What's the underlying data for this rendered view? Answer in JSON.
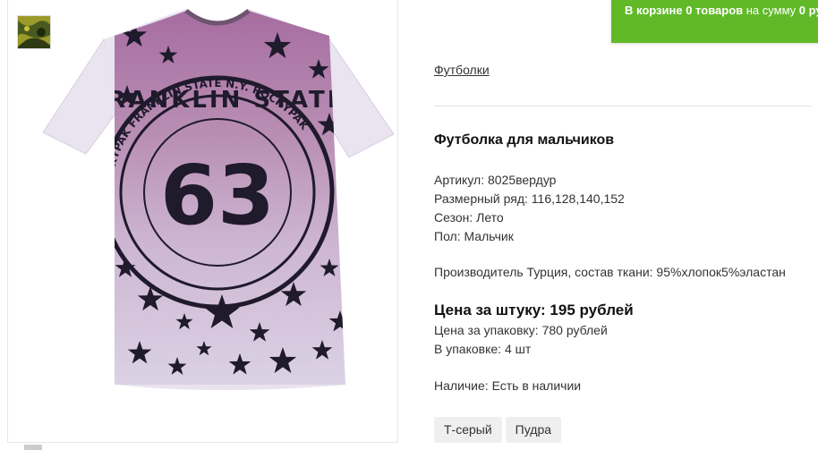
{
  "cart": {
    "prefix": "В корзине",
    "count": "0 товаров",
    "middle": "на сумму",
    "sum": "0 ру"
  },
  "breadcrumb": "Футболки",
  "product": {
    "title": "Футболка для мальчиков",
    "article": "Артикул: 8025вердур",
    "sizes": "Размерный ряд: 116,128,140,152",
    "season": "Сезон: Лето",
    "gender": "Пол: Мальчик",
    "maker": "Производитель Турция, состав ткани: 95%хлопок5%эластан",
    "price": "Цена за штуку: 195 рублей",
    "pack_price": "Цена за упаковку: 780 рублей",
    "pack_qty": "В упаковке: 4 шт",
    "stock": "Наличие: Есть в наличии"
  },
  "colors": [
    "Т-серый",
    "Пудра"
  ],
  "photo": {
    "print_number": "63",
    "print_text": "FRANKLIN STATE",
    "ring_text": "ROCKYPAK FRANKLIN STATE N.Y. ROCKYPAK"
  },
  "accent_color": "#61b928"
}
